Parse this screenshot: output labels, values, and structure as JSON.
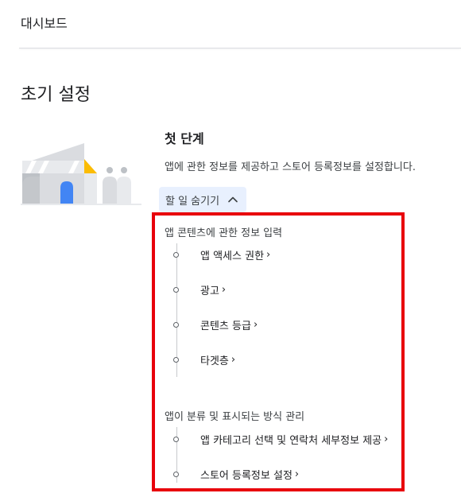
{
  "breadcrumb": "대시보드",
  "page_title": "초기 설정",
  "step": {
    "title": "첫 단계",
    "description": "앱에 관한 정보를 제공하고 스토어 등록정보를 설정합니다.",
    "toggle_label": "할 일 숨기기"
  },
  "sections": [
    {
      "heading": "앱 콘텐츠에 관한 정보 입력",
      "tasks": [
        {
          "label": "앱 액세스 권한",
          "arrow": "›"
        },
        {
          "label": "광고",
          "arrow": "›"
        },
        {
          "label": "콘텐츠 등급",
          "arrow": "›"
        },
        {
          "label": "타겟층",
          "arrow": "›"
        }
      ]
    },
    {
      "heading": "앱이 분류 및 표시되는 방식 관리",
      "tasks": [
        {
          "label": "앱 카테고리 선택 및 연락처 세부정보 제공",
          "arrow": "›"
        },
        {
          "label": "스토어 등록정보 설정",
          "arrow": "›"
        }
      ]
    }
  ],
  "icons": {
    "toggle": "chevron-up-icon",
    "task_marker": "circle-outline-icon",
    "task_arrow": "chevron-right-icon"
  },
  "colors": {
    "highlight_border": "#e8000b",
    "toggle_bg": "#e8f0fe",
    "illustration_blue": "#4285f4",
    "illustration_yellow": "#fbbc04",
    "illustration_gray": "#dadce0"
  }
}
